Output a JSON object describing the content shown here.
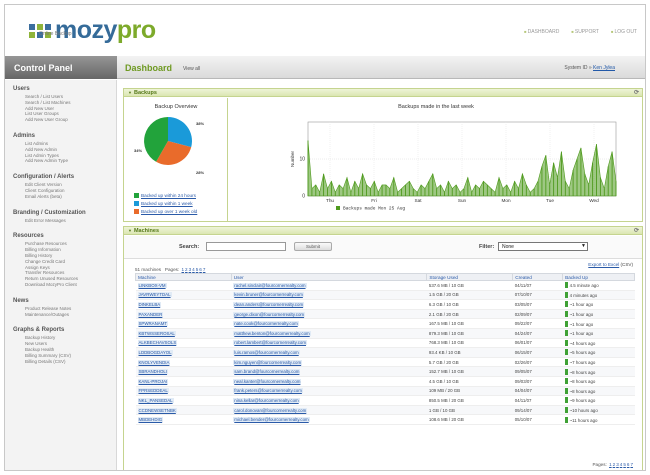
{
  "header": {
    "brand_a": "mozy",
    "brand_b": "pro",
    "tagline": "Online Backup",
    "links": [
      "DASHBOARD",
      "SUPPORT",
      "LOG OUT"
    ]
  },
  "nav": {
    "panel_title": "Control Panel",
    "page_title": "Dashboard",
    "view_all": "View all",
    "system_id_label": "System ID »",
    "user_name": "Ken Jylea"
  },
  "sidebar": [
    {
      "title": "Users",
      "items": [
        "Search / List Users",
        "Search / List Machines",
        "Add New User",
        "List User Groups",
        "Add New User Group"
      ]
    },
    {
      "title": "Admins",
      "items": [
        "List Admins",
        "Add New Admin",
        "List Admin Types",
        "Add New Admin Type"
      ]
    },
    {
      "title": "Configuration / Alerts",
      "items": [
        "Edit Client Version",
        "Client Configuration",
        "Email Alerts (beta)"
      ]
    },
    {
      "title": "Branding / Customization",
      "items": [
        "Edit Error Messages"
      ]
    },
    {
      "title": "Resources",
      "items": [
        "Purchase Resources",
        "Billing Information",
        "Billing History",
        "Change Credit Card",
        "Assign Keys",
        "Transfer Resources",
        "Return Unused Resources",
        "Download MozyPro Client"
      ]
    },
    {
      "title": "News",
      "items": [
        "Product Release Notes",
        "Maintenance/Outages"
      ]
    },
    {
      "title": "Graphs & Reports",
      "items": [
        "Backup History",
        "New Users",
        "Backup Health",
        "Billing Summary (CSV)",
        "Billing Details (CSV)"
      ]
    }
  ],
  "backups": {
    "section_title": "Backups",
    "overview_title": "Backup Overview",
    "pie_labels": [
      "38%",
      "34%",
      "28%"
    ],
    "legend": [
      "Backed up within 24 hours",
      "Backed up within 1 week",
      "Backed up over 1 week old"
    ]
  },
  "machines": {
    "section_title": "Machines",
    "search_label": "Search:",
    "search_value": "",
    "submit_label": "Submit",
    "filter_label": "Filter:",
    "filter_value": "None",
    "count_text": "51 machines",
    "pages_label": "Pages:",
    "pages": [
      "1",
      "2",
      "3",
      "4",
      "5",
      "6",
      "7"
    ],
    "export_label": "Export to Excel",
    "export_suffix": "(CSV)",
    "columns": [
      "Machine",
      "User",
      "Storage Used",
      "Created",
      "Backed Up"
    ],
    "rows": [
      [
        "LINKBOX-VM",
        "rachel.sinclair@fourcornerrealty.com",
        "537.6 MB / 10 GB",
        "04/11/07",
        "4.5 minute ago"
      ],
      [
        "JAVRWEYTDAL",
        "kevin.bruner@fourcornerrealty.com",
        "1.5 GB / 20 GB",
        "07/10/07",
        "4 minutes ago"
      ],
      [
        "DINKELBA",
        "dean.anders@fourcornerrealty.com",
        "6.3 GB / 10 GB",
        "03/05/07",
        "~1 hour ago"
      ],
      [
        "PAXANDER",
        "george.dixon@fourcornerrealty.com",
        "2.1 GB / 20 GB",
        "02/09/07",
        "~1 hour ago"
      ],
      [
        "SPWRANAMT",
        "nate.cook@fourcornerrealty.com",
        "167.5 MB / 10 GB",
        "09/22/07",
        "~1 hour ago"
      ],
      [
        "KBTWSSEROSAL",
        "matthew.benton@fourcornerrealty.com",
        "879.3 MB / 10 GB",
        "04/24/07",
        "~1 hour ago"
      ],
      [
        "ALKBECHAVSOLS",
        "robert.lambert@fourcornerrealty.com",
        "768.3 MB / 10 GB",
        "06/01/07",
        "~4 hours ago"
      ],
      [
        "LDDBOGDAYOL",
        "luis.ramos@fourcornerrealty.com",
        "93.4 KB / 10 GB",
        "06/15/07",
        "~5 hours ago"
      ],
      [
        "KNOLYVENDIA",
        "kim.nguyen@fourcornerrealty.com",
        "5.7 GB / 20 GB",
        "02/26/07",
        "~7 hours ago"
      ],
      [
        "SBRANDHOLI",
        "sam.brand@fourcornerrealty.com",
        "152.7 MB / 10 GB",
        "09/05/07",
        "~8 hours ago"
      ],
      [
        "KANL-PROJAI",
        "neal.kanter@fourcornerrealty.com",
        "4.5 GB / 10 GB",
        "09/03/07",
        "~8 hours ago"
      ],
      [
        "FPRSEDDEAL",
        "frank.peters@fourcornerrealty.com",
        "109 MB / 20 GB",
        "04/04/07",
        "~8 hours ago"
      ],
      [
        "NKL_PANSEDAL",
        "nina.kellar@fourcornerrealty.com",
        "850.5 MB / 20 GB",
        "04/11/07",
        "~9 hours ago"
      ],
      [
        "CCDNEWSETNBK",
        "carol.donovan@fourcornerrealty.com",
        "1 GB / 10 GB",
        "09/14/07",
        "~10 hours ago"
      ],
      [
        "MBDEHDIG",
        "michael.bender@fourcornerrealty.com",
        "108.6 MB / 20 GB",
        "05/10/07",
        "~11 hours ago"
      ]
    ]
  },
  "chart_data": {
    "type": "area",
    "title": "Backups made in the last week",
    "xlabel": "Backups made   Mon   25   Aug",
    "ylabel": "Number",
    "x_ticks": [
      "Thu",
      "Fri",
      "Sat",
      "Sun",
      "Mon",
      "Tue",
      "Wed"
    ],
    "y_ticks": [
      0,
      10
    ],
    "ylim": [
      0,
      20
    ],
    "series": [
      {
        "name": "Backups made",
        "color": "#4f9a1e",
        "values": [
          15,
          2,
          3,
          1,
          6,
          2,
          4,
          1,
          3,
          2,
          5,
          1,
          4,
          2,
          6,
          3,
          2,
          4,
          1,
          3,
          3,
          2,
          5,
          1,
          2,
          3,
          4,
          2,
          1,
          3,
          2,
          4,
          6,
          2,
          3,
          1,
          4,
          2,
          3,
          1,
          2,
          5,
          1,
          3,
          2,
          4,
          3,
          2,
          1,
          5,
          2,
          3,
          1,
          4,
          2,
          6,
          3,
          1,
          2,
          4,
          8,
          11,
          3,
          9,
          5,
          12,
          4,
          2,
          7,
          10,
          13,
          6,
          3,
          9,
          14,
          5,
          2,
          8,
          12,
          4
        ]
      }
    ]
  }
}
